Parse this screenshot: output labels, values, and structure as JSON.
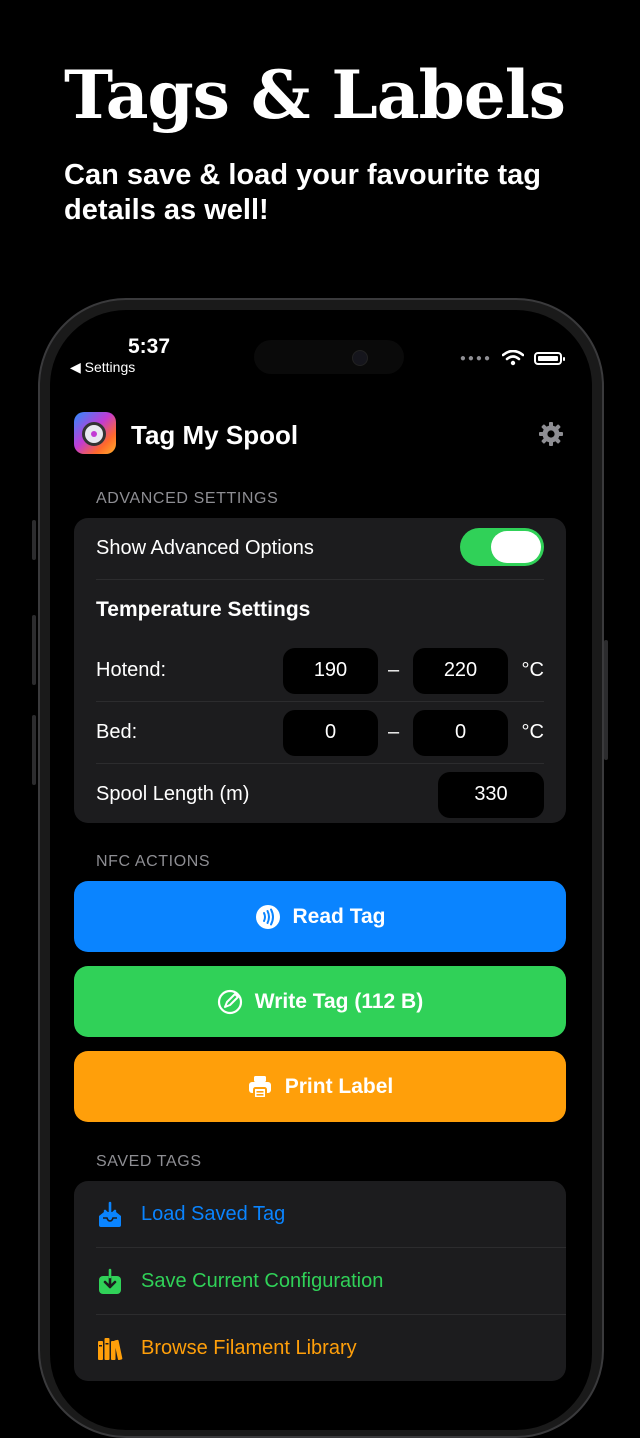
{
  "headline": "Tags & Labels",
  "subline": "Can save & load your favourite tag details as well!",
  "status_bar": {
    "time": "5:37",
    "back_label": "◀ Settings"
  },
  "app": {
    "title": "Tag My Spool"
  },
  "advanced": {
    "section_label": "ADVANCED SETTINGS",
    "show_advanced_label": "Show Advanced Options",
    "show_advanced_on": true,
    "temperature_heading": "Temperature Settings",
    "hotend_label": "Hotend:",
    "hotend_min": "190",
    "hotend_max": "220",
    "bed_label": "Bed:",
    "bed_min": "0",
    "bed_max": "0",
    "range_dash": "–",
    "unit": "°C",
    "spool_length_label": "Spool Length (m)",
    "spool_length": "330"
  },
  "nfc": {
    "section_label": "NFC ACTIONS",
    "read_label": "Read Tag",
    "write_label": "Write Tag (112 B)",
    "print_label": "Print Label",
    "colors": {
      "read": "#0a84ff",
      "write": "#30d158",
      "print": "#ff9f0a"
    }
  },
  "saved": {
    "section_label": "SAVED TAGS",
    "items": [
      {
        "label": "Load Saved Tag",
        "color": "#0a84ff",
        "icon": "tray-download-icon"
      },
      {
        "label": "Save Current Configuration",
        "color": "#30d158",
        "icon": "save-download-icon"
      },
      {
        "label": "Browse Filament Library",
        "color": "#ff9f0a",
        "icon": "books-icon"
      }
    ]
  }
}
